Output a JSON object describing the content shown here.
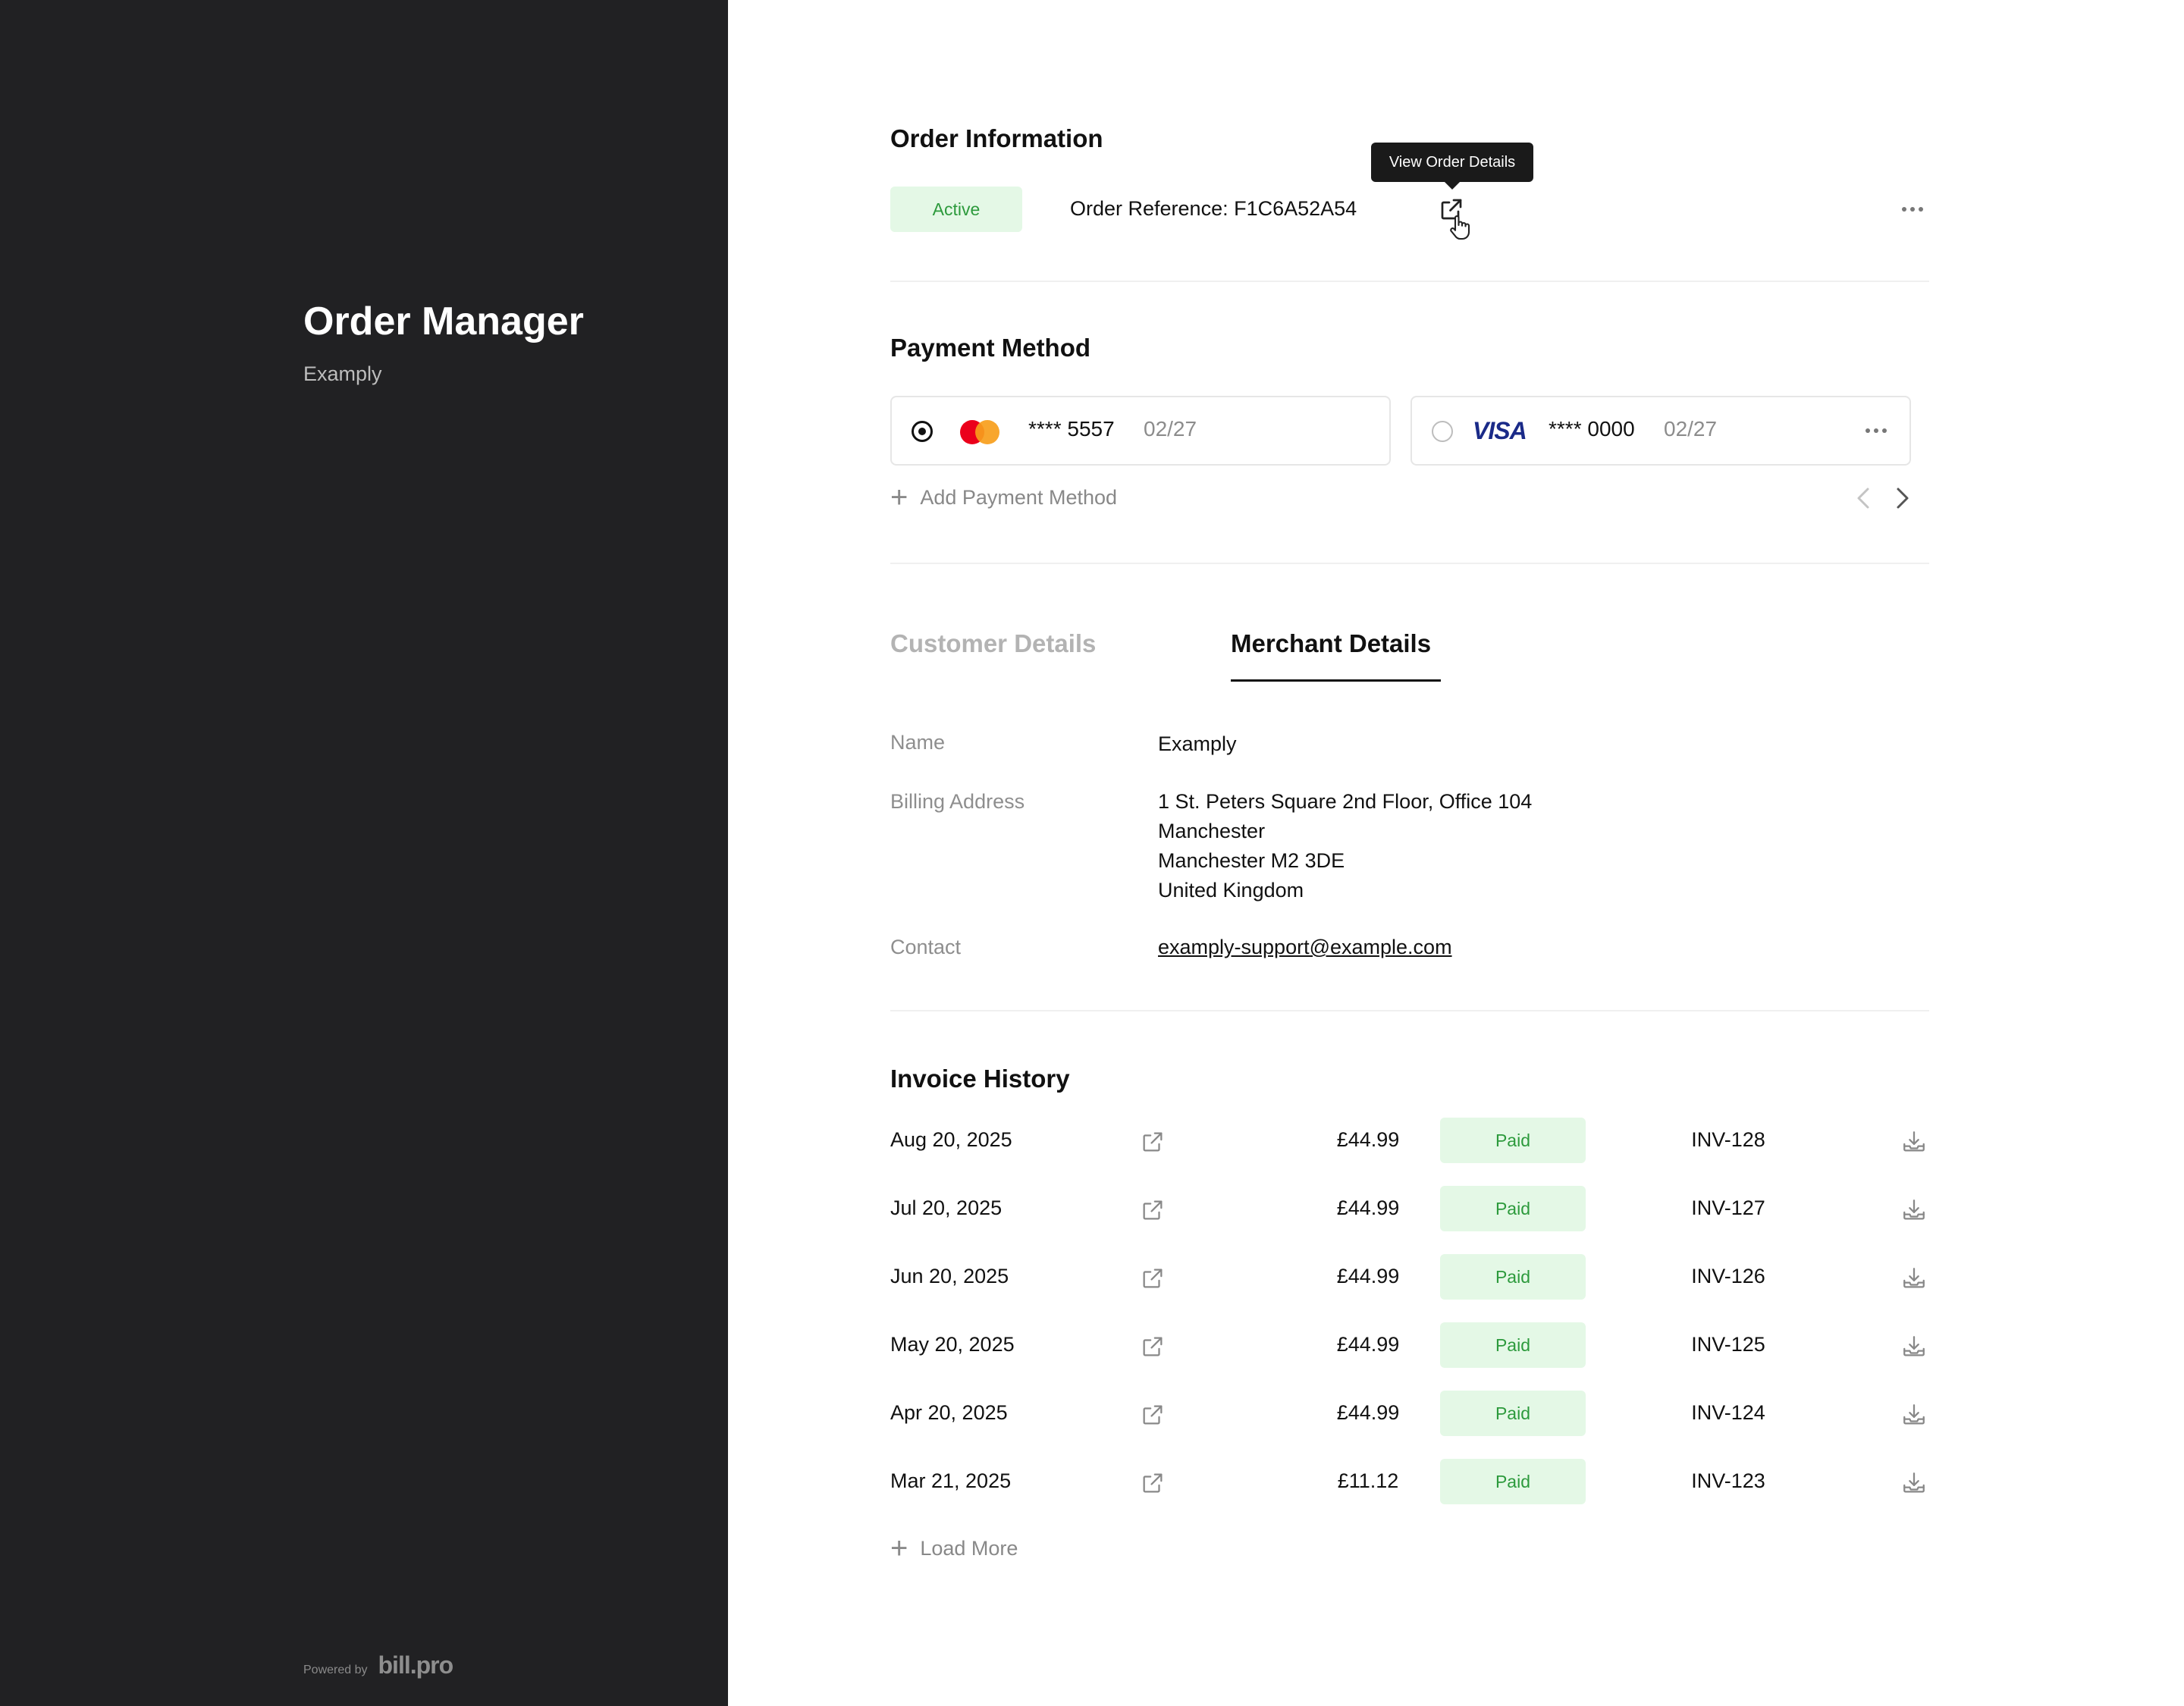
{
  "sidebar": {
    "title": "Order Manager",
    "subtitle": "Examply",
    "powered_label": "Powered by",
    "powered_brand": "bill.pro"
  },
  "order": {
    "section_title": "Order Information",
    "status": "Active",
    "reference": "Order Reference: F1C6A52A54",
    "tooltip": "View Order Details",
    "icons": [
      "external-link-icon",
      "pointer-hand-icon",
      "more-horizontal-icon"
    ]
  },
  "payment": {
    "section_title": "Payment Method",
    "cards": [
      {
        "brand": "mastercard",
        "number": "**** 5557",
        "expiry": "02/27",
        "selected": true
      },
      {
        "brand": "VISA",
        "number": "**** 0000",
        "expiry": "02/27",
        "selected": false
      }
    ],
    "add_label": "Add Payment Method"
  },
  "tabs": [
    {
      "label": "Customer Details",
      "active": false
    },
    {
      "label": "Merchant Details",
      "active": true
    }
  ],
  "merchant": {
    "name_label": "Name",
    "name": "Examply",
    "address_label": "Billing Address",
    "address": [
      "1 St. Peters Square 2nd Floor, Office 104",
      "Manchester",
      "Manchester M2 3DE",
      "United Kingdom"
    ],
    "contact_label": "Contact",
    "contact": "examply-support@example.com"
  },
  "invoices": {
    "section_title": "Invoice History",
    "rows": [
      {
        "date": "Aug 20, 2025",
        "amount": "£44.99",
        "status": "Paid",
        "number": "INV-128"
      },
      {
        "date": "Jul 20, 2025",
        "amount": "£44.99",
        "status": "Paid",
        "number": "INV-127"
      },
      {
        "date": "Jun 20, 2025",
        "amount": "£44.99",
        "status": "Paid",
        "number": "INV-126"
      },
      {
        "date": "May 20, 2025",
        "amount": "£44.99",
        "status": "Paid",
        "number": "INV-125"
      },
      {
        "date": "Apr 20, 2025",
        "amount": "£44.99",
        "status": "Paid",
        "number": "INV-124"
      },
      {
        "date": "Mar 21, 2025",
        "amount": "£11.12",
        "status": "Paid",
        "number": "INV-123"
      }
    ],
    "load_more": "Load More"
  },
  "colors": {
    "sidebar_bg": "#212123",
    "badge_bg": "#e4f8e6",
    "badge_text": "#2c9a3c",
    "visa_blue": "#1a2a88",
    "mastercard_red": "#eb001b",
    "mastercard_orange": "#f79e1b"
  }
}
